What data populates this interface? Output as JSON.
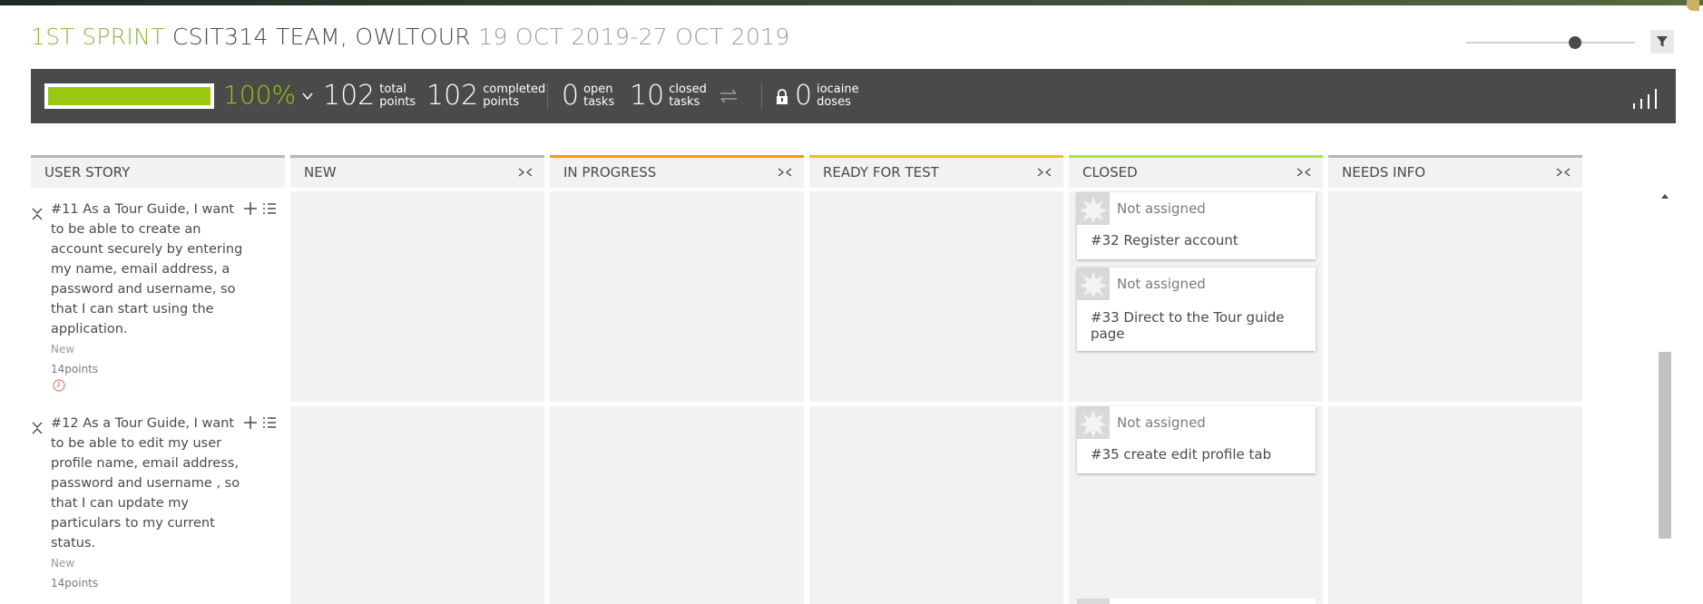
{
  "header": {
    "sprint": "1ST SPRINT",
    "team": "CSIT314 TEAM, OWLTOUR",
    "dates": "19 OCT 2019-27 OCT 2019"
  },
  "summary": {
    "progress_percent": 100,
    "percent_label": "100%",
    "total_points": "102",
    "total_points_label_1": "total",
    "total_points_label_2": "points",
    "completed_points": "102",
    "completed_label_1": "completed",
    "completed_label_2": "points",
    "open_tasks": "0",
    "open_label_1": "open",
    "open_label_2": "tasks",
    "closed_tasks": "10",
    "closed_label_1": "closed",
    "closed_label_2": "tasks",
    "iocaine": "0",
    "iocaine_label_1": "iocaine",
    "iocaine_label_2": "doses"
  },
  "columns": [
    {
      "label": "USER STORY",
      "color": "#b5b5b5"
    },
    {
      "label": "NEW",
      "color": "#b5b5b5"
    },
    {
      "label": "IN PROGRESS",
      "color": "#ff9900"
    },
    {
      "label": "READY FOR TEST",
      "color": "#fcc000"
    },
    {
      "label": "CLOSED",
      "color": "#a8e440"
    },
    {
      "label": "NEEDS INFO",
      "color": "#b5b5b5"
    }
  ],
  "stories": [
    {
      "text": "#11 As a Tour Guide, I want to be able to create an account securely by entering my name, email address, a password and username, so that I can start using the application.",
      "status": "New",
      "points": "14points",
      "cards": [
        {
          "assigned": "Not assigned",
          "title": "#32 Register account"
        },
        {
          "assigned": "Not assigned",
          "title": "#33 Direct to the Tour guide page"
        }
      ]
    },
    {
      "text": "#12 As a Tour Guide, I want to be able to edit my user profile name, email address, password and username , so that I can update my particulars to my current status.",
      "status": "New",
      "points": "14points",
      "cards": [
        {
          "assigned": "Not assigned",
          "title": "#35 create edit profile tab"
        }
      ]
    }
  ],
  "icons": [
    "filter-icon",
    "chevron-down-icon",
    "swap-icon",
    "lock-icon",
    "signal-bars-icon",
    "fold-icon",
    "collapse-icon",
    "add-icon",
    "list-icon",
    "clock-icon",
    "avatar-icon",
    "scroll-up-icon"
  ]
}
